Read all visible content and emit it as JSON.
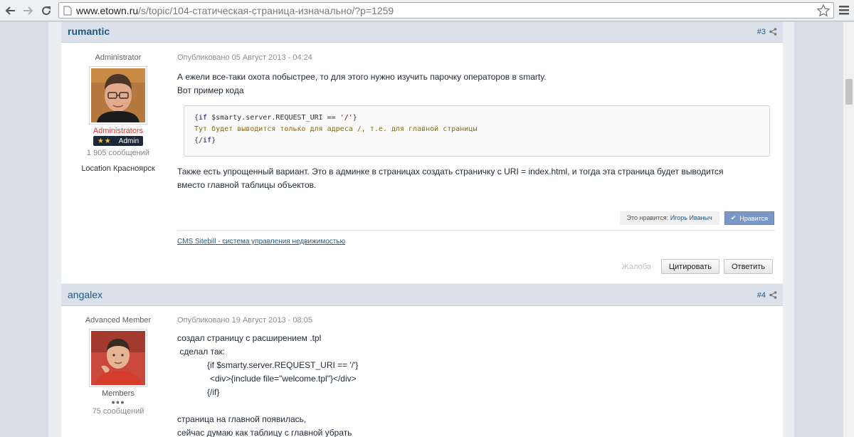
{
  "browser": {
    "url_host": "www.etown.ru",
    "url_path": "/s/topic/104-статическая-страница-изначально/?p=1259"
  },
  "posts": [
    {
      "author": "rumantic",
      "number": "#3",
      "role_title": "Administrator",
      "group": "Administrators",
      "badge": "Admin",
      "badge_stars": "★★",
      "post_count": "1 905 сообщений",
      "location": "Location Красноярск",
      "posted": "Опубликовано 05 Август 2013 - 04:24",
      "lines": [
        "А ежели все-таки охота побыстрее, то для этого нужно изучить парочку операторов в smarty.",
        "Вот пример кода"
      ],
      "code": {
        "line1_open": "{",
        "line1_kw": "if",
        "line1_rest": " $smarty.server.REQUEST_URI == ",
        "line1_str": "'/'",
        "line1_close": "}",
        "line2": "Тут будет выводится только для адреса /, т.е. для главной страницы",
        "line3_open": "{/",
        "line3_kw": "if",
        "line3_close": "}"
      },
      "after_code": [
        "Также есть упрощенный вариант. Это в админке в страницах создать страничку с URI = index.html, и тогда эта страница будет выводится",
        "вместо главной таблицы объектов."
      ],
      "likes_prefix": "Это нравится: ",
      "likes_name": "Игорь Иваныч",
      "like_button": "Нравится",
      "signature": "CMS Sitebill - система управления недвижимостью",
      "report": "Жалоба",
      "quote_button": "Цитировать",
      "reply_button": "Ответить"
    },
    {
      "author": "angalex",
      "number": "#4",
      "role_title": "Advanced Member",
      "group": "Members",
      "pips": "●●●",
      "post_count": "75 сообщений",
      "posted": "Опубликовано 19 Август 2013 - 08:05",
      "lines": [
        "создал страницу с расширением .tpl",
        " сделал так:",
        "{if $smarty.server.REQUEST_URI == '/'}",
        "<div>{include file=\"welcome.tpl\"}</div>",
        "{/if}",
        "",
        "страница на главной появилась,",
        "сейчас думаю как таблицу с главной убрать"
      ]
    }
  ]
}
